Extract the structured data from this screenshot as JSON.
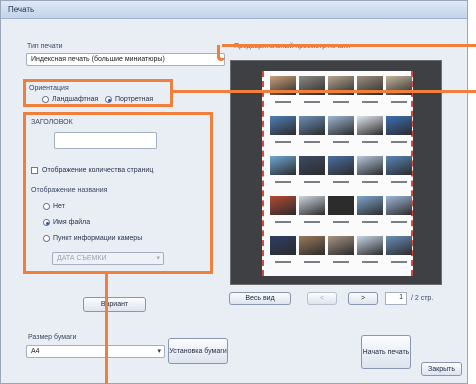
{
  "window": {
    "title": "Печать"
  },
  "print_type": {
    "label": "Тип печати",
    "value": "Индексная печать (большие миниатюры)"
  },
  "preview": {
    "label": "Предварительный просмотр печати"
  },
  "orientation": {
    "label": "Ориентация",
    "options": [
      {
        "label": "Ландшафтная",
        "selected": false
      },
      {
        "label": "Портретная",
        "selected": true
      }
    ]
  },
  "heading": {
    "label": "ЗАГОЛОВОК",
    "value": ""
  },
  "page_count": {
    "label": "Отображение количества страниц",
    "checked": false
  },
  "name_display": {
    "label": "Отображение названия",
    "options": [
      {
        "label": "Нет",
        "selected": false
      },
      {
        "label": "Имя файла",
        "selected": true
      },
      {
        "label": "Пункт информации камеры",
        "selected": false
      }
    ],
    "camera_item": {
      "value": "ДАТА СЪЕМКИ",
      "enabled": false
    }
  },
  "buttons": {
    "settings": "Вариант",
    "whole_view": "Весь вид",
    "prev": "<",
    "next": ">",
    "paper_settings": "Установка бумаги",
    "print": "Начать печать",
    "close": "Закрыть"
  },
  "pager": {
    "current": "1",
    "total": "/ 2 стр."
  },
  "paper": {
    "label": "Размер бумаги",
    "value": "A4"
  },
  "colors": {
    "highlight": "#f07f3c",
    "preview_bg": "#3f4043",
    "window_bg": "#e9edf4"
  },
  "thumbnails": [
    [
      "#c9a07a",
      "#8f8a83",
      "#b7a48e",
      "#9e8f7f",
      "#c6b49c"
    ],
    [
      "#4f7fb7",
      "#6c8fb9",
      "#9eb6d4",
      "#e2e7ee",
      "#3d70b5"
    ],
    [
      "#6fa8d6",
      "#3d4c65",
      "#4a6fa3",
      "#b6c8de",
      "#5a86b8"
    ],
    [
      "#b34a35",
      "#cfd6df",
      "#2c2c2c",
      "#7fa6cc",
      "#9fb8d8"
    ],
    [
      "#2f3e66",
      "#9a7a5c",
      "#a69484",
      "#c8d5e6",
      "#6b8fb8"
    ]
  ]
}
